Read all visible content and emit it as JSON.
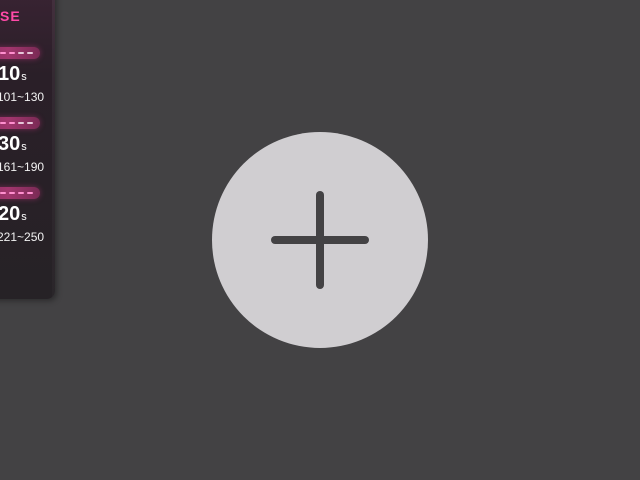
{
  "panel": {
    "header": "SE",
    "levels": [
      {
        "value": "10",
        "unit": "s",
        "range": "101~130"
      },
      {
        "value": "30",
        "unit": "s",
        "range": "161~190"
      },
      {
        "value": "20",
        "unit": "s",
        "range": "221~250"
      }
    ]
  },
  "add_button": {
    "icon": "plus-icon"
  },
  "colors": {
    "background": "#434244",
    "accent": "#ff4aa8",
    "button_fill": "#d0ced1",
    "icon_stroke": "#434244"
  }
}
